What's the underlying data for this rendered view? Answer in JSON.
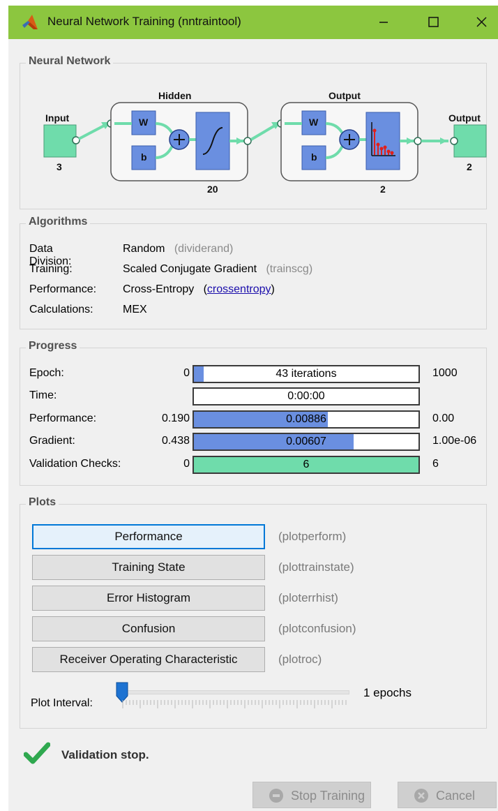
{
  "titlebar": {
    "title": "Neural Network Training (nntraintool)",
    "icons": {
      "app": "matlab-icon",
      "minimize": "minimize-icon",
      "maximize": "maximize-icon",
      "close": "close-icon"
    }
  },
  "neural_network": {
    "group_title": "Neural Network",
    "input_label": "Input",
    "input_size": "3",
    "hidden_label": "Hidden",
    "hidden_size": "20",
    "output_layer_label": "Output",
    "output_layer_size": "2",
    "output_label": "Output",
    "output_size": "2",
    "weight_label": "W",
    "bias_label": "b"
  },
  "algorithms": {
    "group_title": "Algorithms",
    "rows": [
      {
        "key": "Data Division:",
        "value": "Random",
        "fn": "(dividerand)"
      },
      {
        "key": "Training:",
        "value": "Scaled Conjugate Gradient",
        "fn": "(trainscg)"
      },
      {
        "key": "Performance:",
        "value": "Cross-Entropy",
        "fn_open": "(",
        "fn_link": "crossentropy",
        "fn_close": ")"
      },
      {
        "key": "Calculations:",
        "value": "MEX"
      }
    ]
  },
  "progress": {
    "group_title": "Progress",
    "rows": [
      {
        "key": "Epoch:",
        "start": "0",
        "bar_text": "43 iterations",
        "end": "1000",
        "fill": 0.043,
        "fill_color": "#6a8fe0"
      },
      {
        "key": "Time:",
        "start": "",
        "bar_text": "0:00:00",
        "end": "",
        "fill": 0,
        "fill_color": "#6a8fe0"
      },
      {
        "key": "Performance:",
        "start": "0.190",
        "bar_text": "0.00886",
        "end": "0.00",
        "fill": 0.595,
        "fill_color": "#6a8fe0"
      },
      {
        "key": "Gradient:",
        "start": "0.438",
        "bar_text": "0.00607",
        "end": "1.00e-06",
        "fill": 0.71,
        "fill_color": "#6a8fe0"
      },
      {
        "key": "Validation Checks:",
        "start": "0",
        "bar_text": "6",
        "end": "6",
        "fill": 1.0,
        "fill_color": "#6fdcab"
      }
    ]
  },
  "plots": {
    "group_title": "Plots",
    "buttons": [
      {
        "label": "Performance",
        "fn": "(plotperform)"
      },
      {
        "label": "Training State",
        "fn": "(plottrainstate)"
      },
      {
        "label": "Error Histogram",
        "fn": "(ploterrhist)"
      },
      {
        "label": "Confusion",
        "fn": "(plotconfusion)"
      },
      {
        "label": "Receiver Operating Characteristic",
        "fn": "(plotroc)"
      }
    ],
    "interval_label": "Plot Interval:",
    "interval_value": "1 epochs",
    "interval_fraction": 0.0
  },
  "status": {
    "icon": "check-icon",
    "text": "Validation stop."
  },
  "footer": {
    "stop_label": "Stop Training",
    "cancel_label": "Cancel",
    "stop_icon": "stop-icon",
    "cancel_icon": "cancel-icon"
  },
  "colors": {
    "titlebar": "#8cc63f",
    "layer_block": "#6a8fe0",
    "io_block": "#6fdcab",
    "progress_fill": "#6a8fe0",
    "validation_fill": "#6fdcab",
    "selected_border": "#0078d7",
    "link": "#1a0dab"
  }
}
